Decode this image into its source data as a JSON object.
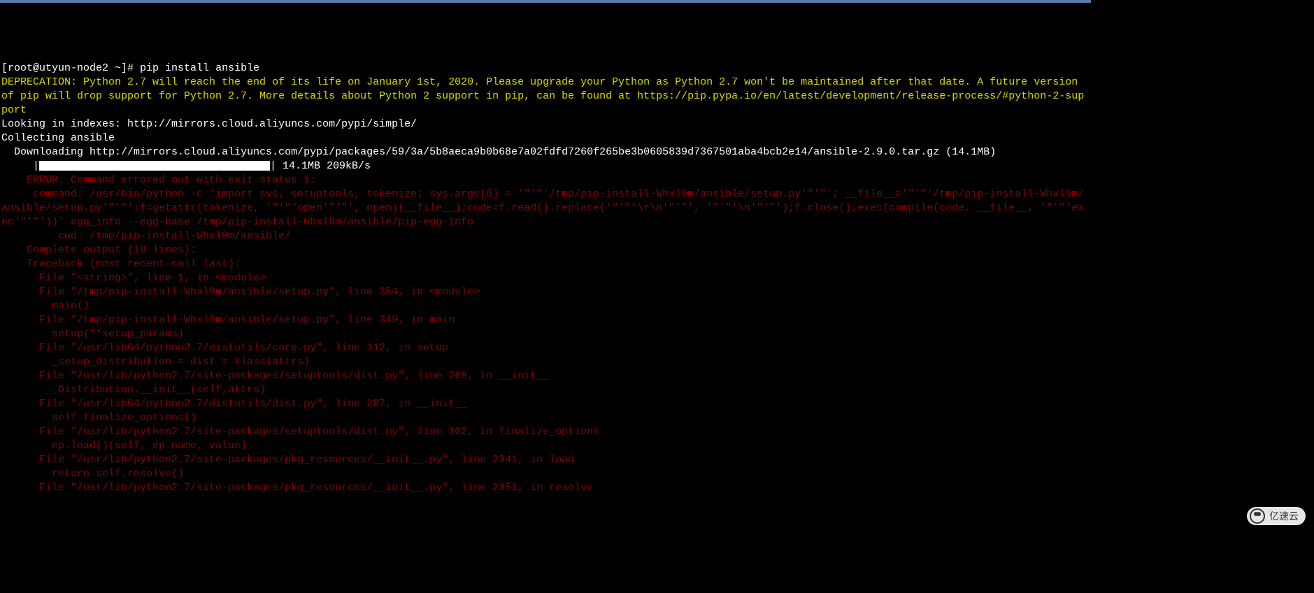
{
  "prompt": "[root@utyun-node2 ~]# ",
  "command": "pip install ansible",
  "deprecation": "DEPRECATION: Python 2.7 will reach the end of its life on January 1st, 2020. Please upgrade your Python as Python 2.7 won't be maintained after that date. A future version of pip will drop support for Python 2.7. More details about Python 2 support in pip, can be found at https://pip.pypa.io/en/latest/development/release-process/#python-2-support",
  "looking": "Looking in indexes: http://mirrors.cloud.aliyuncs.com/pypi/simple/",
  "collecting": "Collecting ansible",
  "downloading": "  Downloading http://mirrors.cloud.aliyuncs.com/pypi/packages/59/3a/5b8aeca9b0b68e7a02fdfd7260f265be3b0605839d7367501aba4bcb2e14/ansible-2.9.0.tar.gz (14.1MB)",
  "progress_prefix": "     |",
  "progress_suffix": "| 14.1MB 209kB/s",
  "error_lines": [
    "    ERROR: Command errored out with exit status 1:",
    "     command: /usr/bin/python -c 'import sys, setuptools, tokenize; sys.argv[0] = '\"'\"'/tmp/pip-install-Whxl9m/ansible/setup.py'\"'\"'; __file__='\"'\"'/tmp/pip-install-Whxl9m/ansible/setup.py'\"'\"';f=getattr(tokenize, '\"'\"'open'\"'\"', open)(__file__);code=f.read().replace('\"'\"'\\r\\n'\"'\"', '\"'\"'\\n'\"'\"');f.close();exec(compile(code, __file__, '\"'\"'exec'\"'\"'))' egg_info --egg-base /tmp/pip-install-Whxl9m/ansible/pip-egg-info",
    "         cwd: /tmp/pip-install-Whxl9m/ansible/",
    "    Complete output (19 lines):",
    "    Traceback (most recent call last):",
    "      File \"<string>\", line 1, in <module>",
    "      File \"/tmp/pip-install-Whxl9m/ansible/setup.py\", line 354, in <module>",
    "        main()",
    "      File \"/tmp/pip-install-Whxl9m/ansible/setup.py\", line 349, in main",
    "        setup(**setup_params)",
    "      File \"/usr/lib64/python2.7/distutils/core.py\", line 112, in setup",
    "        _setup_distribution = dist = klass(attrs)",
    "      File \"/usr/lib/python2.7/site-packages/setuptools/dist.py\", line 269, in __init__",
    "        _Distribution.__init__(self,attrs)",
    "      File \"/usr/lib64/python2.7/distutils/dist.py\", line 287, in __init__",
    "        self.finalize_options()",
    "      File \"/usr/lib/python2.7/site-packages/setuptools/dist.py\", line 302, in finalize_options",
    "        ep.load()(self, ep.name, value)",
    "      File \"/usr/lib/python2.7/site-packages/pkg_resources/__init__.py\", line 2341, in load",
    "        return self.resolve()",
    "      File \"/usr/lib/python2.7/site-packages/pkg_resources/__init__.py\", line 2351, in resolve"
  ],
  "watermark": "亿速云"
}
